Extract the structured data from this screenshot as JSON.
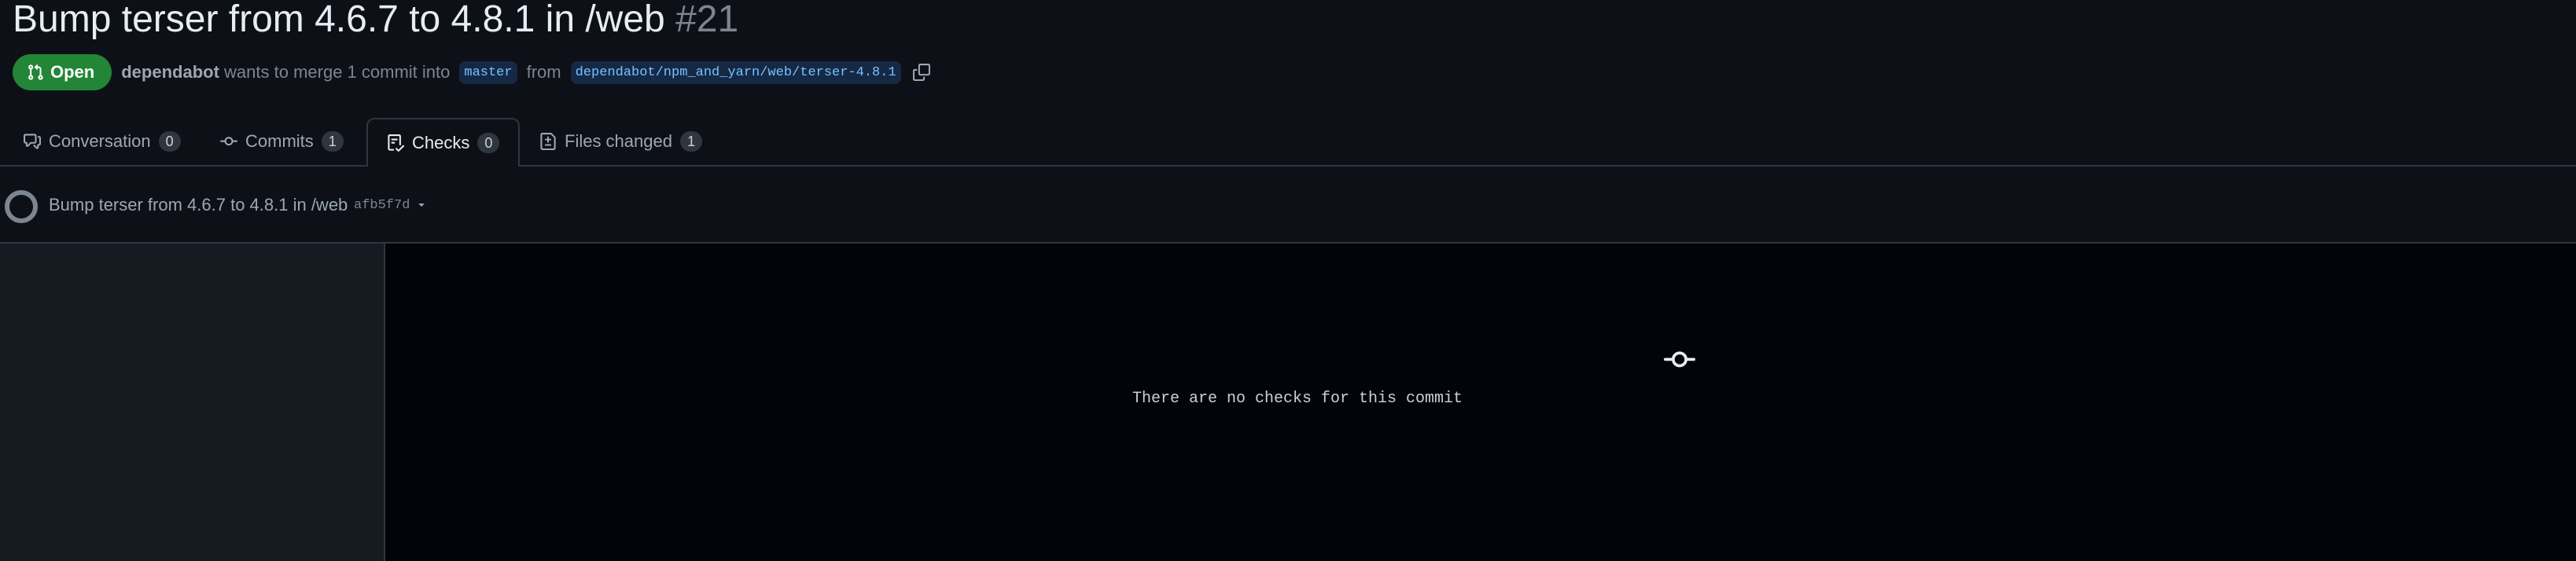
{
  "pr": {
    "title": "Bump terser from 4.6.7 to 4.8.1 in /web",
    "number": "#21",
    "state": "Open",
    "author": "dependabot",
    "merge_text": "wants to merge 1 commit into",
    "base_branch": "master",
    "from_text": "from",
    "head_branch": "dependabot/npm_and_yarn/web/terser-4.8.1"
  },
  "tabs": [
    {
      "label": "Conversation",
      "count": "0"
    },
    {
      "label": "Commits",
      "count": "1"
    },
    {
      "label": "Checks",
      "count": "0"
    },
    {
      "label": "Files changed",
      "count": "1"
    }
  ],
  "commit": {
    "title": "Bump terser from 4.6.7 to 4.8.1 in /web",
    "sha": "afb5f7d"
  },
  "checks": {
    "empty_message": "There are no checks for this commit"
  },
  "colors": {
    "open_badge": "#238636",
    "background": "#0d1117",
    "branch_text": "#79c0ff"
  }
}
